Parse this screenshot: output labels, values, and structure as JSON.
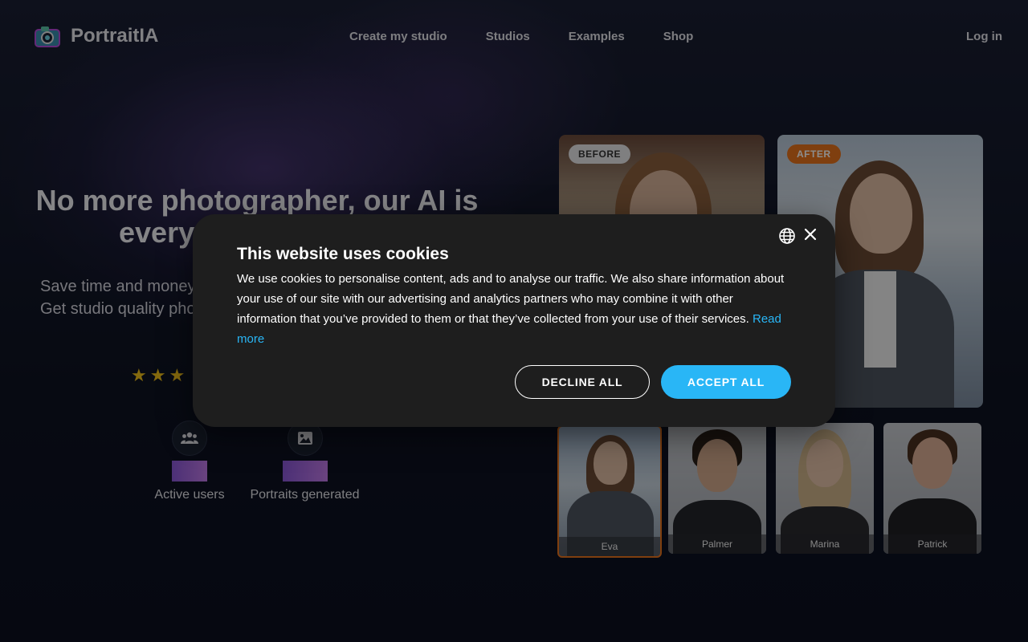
{
  "header": {
    "logo_text": "PortraitIA",
    "nav": [
      "Create my studio",
      "Studios",
      "Examples",
      "Shop"
    ],
    "login": "Log in"
  },
  "hero": {
    "title_line1": "No more photographer, our AI is",
    "title_line2": "everyt",
    "subtitle_line1": "Save time and money",
    "subtitle_line2": "Get studio quality pho",
    "rating_stars_visible": 3
  },
  "stats": [
    {
      "label": "Active users",
      "icon": "users-icon"
    },
    {
      "label": "Portraits generated",
      "icon": "image-icon"
    }
  ],
  "gallery": {
    "before_label": "BEFORE",
    "after_label": "AFTER",
    "thumbnails": [
      "Eva",
      "Palmer",
      "Marina",
      "Patrick"
    ],
    "selected": "Eva"
  },
  "cookie_modal": {
    "title": "This website uses cookies",
    "body": "We use cookies to personalise content, ads and to analyse our traffic. We also share information about your use of our site with our advertising and analytics partners who may combine it with other information that you’ve provided to them or that they’ve collected from your use of their services.",
    "read_more": "Read more",
    "decline": "DECLINE ALL",
    "accept": "ACCEPT ALL"
  },
  "colors": {
    "accent_blue": "#29b6f6",
    "after_badge": "#e8731c",
    "star": "#f3c11a",
    "modal_bg": "#1e1e1e"
  }
}
